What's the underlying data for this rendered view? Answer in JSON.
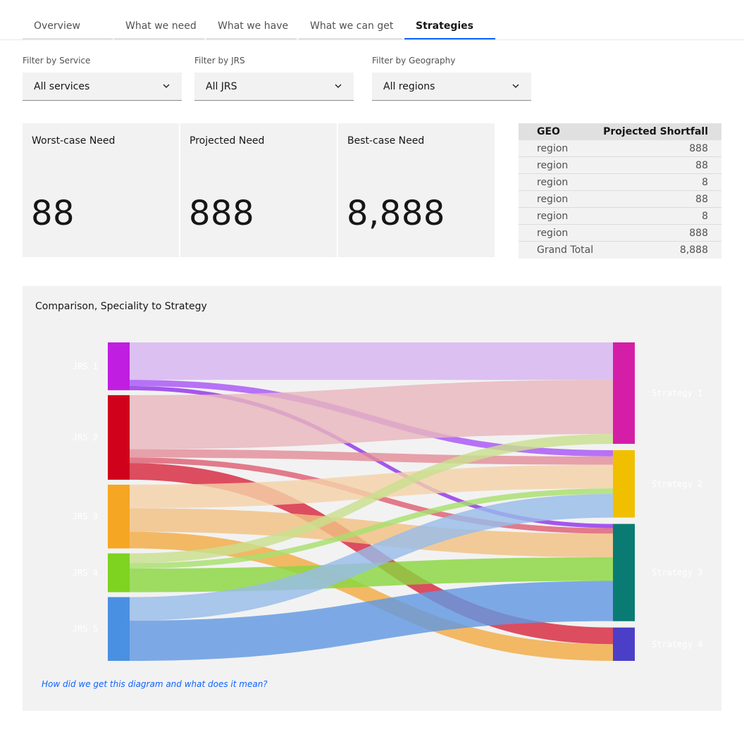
{
  "tabs": [
    {
      "label": "Overview",
      "active": false
    },
    {
      "label": "What we need",
      "active": false
    },
    {
      "label": "What we have",
      "active": false
    },
    {
      "label": "What we can get",
      "active": false
    },
    {
      "label": "Strategies",
      "active": true
    }
  ],
  "filters": [
    {
      "label": "Filter by Service",
      "value": "All services"
    },
    {
      "label": "Filter by JRS",
      "value": "All JRS"
    },
    {
      "label": "Filter by Geography",
      "value": "All regions"
    }
  ],
  "kpis": [
    {
      "label": "Worst-case Need",
      "value": "88"
    },
    {
      "label": "Projected Need",
      "value": "888"
    },
    {
      "label": "Best-case Need",
      "value": "8,888"
    }
  ],
  "geo_table": {
    "headers": [
      "GEO",
      "Projected Shortfall"
    ],
    "rows": [
      [
        "region",
        "888"
      ],
      [
        "region",
        "88"
      ],
      [
        "region",
        "8"
      ],
      [
        "region",
        "88"
      ],
      [
        "region",
        "8"
      ],
      [
        "region",
        "888"
      ]
    ],
    "total": [
      "Grand Total",
      "8,888"
    ]
  },
  "diagram": {
    "title": "Comparison, Speciality to Strategy",
    "help_link": "How did we get this diagram and what does it mean?",
    "sources": [
      {
        "label": "JRS 1",
        "color": "#c01ee0"
      },
      {
        "label": "JRS 2",
        "color": "#d0021b"
      },
      {
        "label": "JRS 3",
        "color": "#f5a623"
      },
      {
        "label": "JRS 4",
        "color": "#7ed321"
      },
      {
        "label": "JRS 5",
        "color": "#4a90e2"
      }
    ],
    "targets": [
      {
        "label": "Strategy 1",
        "color": "#d51ea7"
      },
      {
        "label": "Strategy 2",
        "color": "#f0c000"
      },
      {
        "label": "Strategy 3",
        "color": "#0a7b73"
      },
      {
        "label": "Strategy 4",
        "color": "#4c3fc7"
      }
    ],
    "links": [
      {
        "source": "JRS 1",
        "target": "Strategy 1",
        "value": 54,
        "color": "#d7b4f2"
      },
      {
        "source": "JRS 1",
        "target": "Strategy 2",
        "value": 9,
        "color": "#a855f7"
      },
      {
        "source": "JRS 1",
        "target": "Strategy 3",
        "value": 6,
        "color": "#9333ea"
      },
      {
        "source": "JRS 2",
        "target": "Strategy 1",
        "value": 78,
        "color": "#e8b7bd"
      },
      {
        "source": "JRS 2",
        "target": "Strategy 2",
        "value": 12,
        "color": "#e38d99"
      },
      {
        "source": "JRS 2",
        "target": "Strategy 3",
        "value": 8,
        "color": "#de5f73"
      },
      {
        "source": "JRS 2",
        "target": "Strategy 4",
        "value": 24,
        "color": "#d7283e"
      },
      {
        "source": "JRS 3",
        "target": "Strategy 2",
        "value": 34,
        "color": "#f4d2a8"
      },
      {
        "source": "JRS 3",
        "target": "Strategy 3",
        "value": 34,
        "color": "#f1c184"
      },
      {
        "source": "JRS 3",
        "target": "Strategy 4",
        "value": 24,
        "color": "#f2ab44"
      },
      {
        "source": "JRS 4",
        "target": "Strategy 1",
        "value": 14,
        "color": "#c9df8e"
      },
      {
        "source": "JRS 4",
        "target": "Strategy 2",
        "value": 8,
        "color": "#a8df6e"
      },
      {
        "source": "JRS 4",
        "target": "Strategy 3",
        "value": 34,
        "color": "#8ad73f"
      },
      {
        "source": "JRS 5",
        "target": "Strategy 2",
        "value": 34,
        "color": "#98bce9"
      },
      {
        "source": "JRS 5",
        "target": "Strategy 3",
        "value": 58,
        "color": "#6199e2"
      }
    ]
  }
}
